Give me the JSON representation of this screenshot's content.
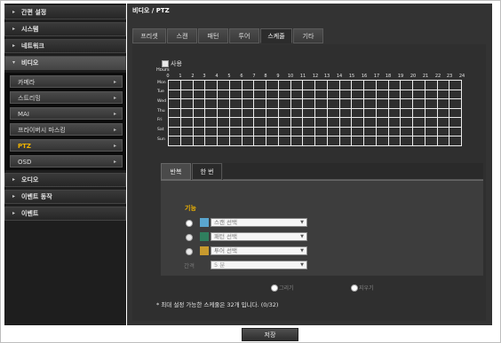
{
  "sidebar": {
    "items": [
      {
        "label": "간편 설정"
      },
      {
        "label": "시스템"
      },
      {
        "label": "네트워크"
      },
      {
        "label": "비디오"
      },
      {
        "label": "오디오"
      },
      {
        "label": "이벤트 동작"
      },
      {
        "label": "이벤트"
      }
    ],
    "video_sub": [
      {
        "label": "카메라"
      },
      {
        "label": "스트리밍"
      },
      {
        "label": "MAI"
      },
      {
        "label": "프라이버시 마스킹"
      },
      {
        "label": "PTZ"
      },
      {
        "label": "OSD"
      }
    ]
  },
  "main": {
    "title": "비디오 / PTZ",
    "tabs": [
      {
        "label": "프리셋"
      },
      {
        "label": "스캔"
      },
      {
        "label": "패턴"
      },
      {
        "label": "투어"
      },
      {
        "label": "스케줄"
      },
      {
        "label": "기타"
      }
    ],
    "use_label": "사용",
    "hours_label": "Hours",
    "hours": [
      "0",
      "1",
      "2",
      "3",
      "4",
      "5",
      "6",
      "7",
      "8",
      "9",
      "10",
      "11",
      "12",
      "13",
      "14",
      "15",
      "16",
      "17",
      "18",
      "19",
      "20",
      "21",
      "22",
      "23",
      "24"
    ],
    "days": [
      "Mon",
      "Tue",
      "Wed",
      "Thu",
      "Fri",
      "Sat",
      "Sun"
    ],
    "subtabs": [
      {
        "label": "반복"
      },
      {
        "label": "한 번"
      }
    ],
    "function_label": "기능",
    "functions": [
      {
        "value": "스캔 선택",
        "color": "#5aa6cf"
      },
      {
        "value": "패턴 선택",
        "color": "#2f7f5e"
      },
      {
        "value": "투어 선택",
        "color": "#c89a2e"
      }
    ],
    "interval_label": "간격",
    "interval_value": "5 분",
    "erase_label": "그리기",
    "clear_label": "지우기",
    "note": "* 최대 설정 가능한 스케줄은 32개 입니다. (0/32)"
  },
  "footer": {
    "save_label": "저장"
  }
}
